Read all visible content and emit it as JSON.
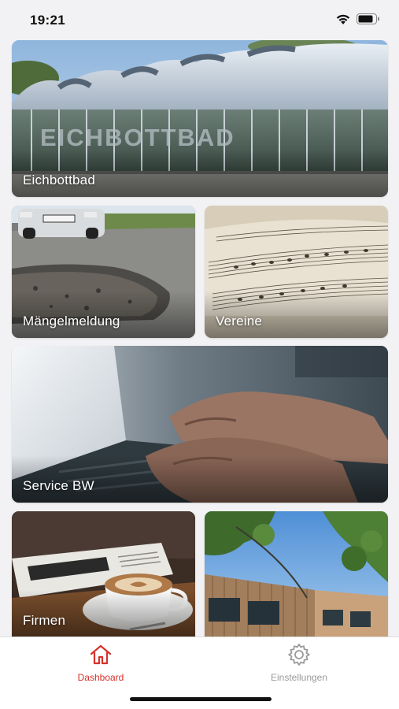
{
  "status_bar": {
    "time": "19:21"
  },
  "tiles": [
    {
      "label": "Eichbottbad",
      "sign_text": "EICHBOTTBAD"
    },
    {
      "label": "Mängelmeldung"
    },
    {
      "label": "Vereine"
    },
    {
      "label": "Service BW"
    },
    {
      "label": "Firmen"
    },
    {
      "label": ""
    }
  ],
  "tab_bar": {
    "tabs": [
      {
        "label": "Dashboard",
        "icon": "home-icon",
        "active": true
      },
      {
        "label": "Einstellungen",
        "icon": "gear-icon",
        "active": false
      }
    ]
  },
  "colors": {
    "accent": "#d6302b",
    "inactive": "#9a9a9a",
    "background": "#f2f2f4"
  }
}
